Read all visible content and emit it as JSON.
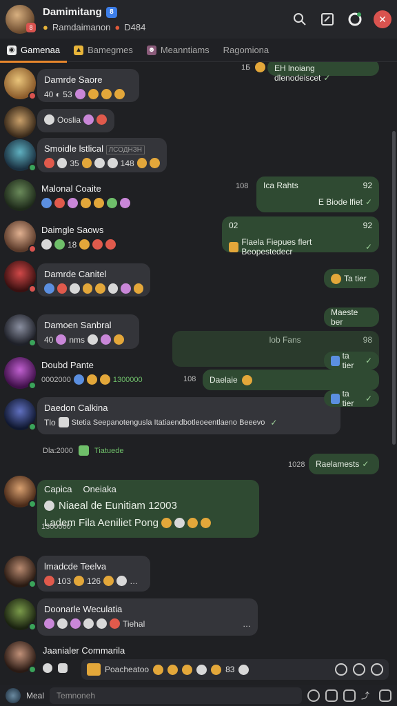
{
  "header": {
    "title": "Damimitang",
    "subtitle": "Ramdaimanon",
    "subtitle_count": "D484",
    "avatar_badge": "8",
    "title_badge": "8"
  },
  "tabs": [
    {
      "label": "Gamenaa",
      "active": true
    },
    {
      "label": "Bamegmes"
    },
    {
      "label": "Meanntiams"
    },
    {
      "label": "Ragomiona"
    }
  ],
  "messages": {
    "m0_out": {
      "time": "1Б",
      "text": "EH lnoiang dlenodeiscet"
    },
    "m1": {
      "name": "Damrde Saore",
      "line": "40 ◐ 53"
    },
    "m2": {
      "line": "Ooslia"
    },
    "m3": {
      "name": "Smoidle lstlical",
      "tag": "ЛСОДНЗН",
      "line": "35",
      "count": "148"
    },
    "m4": {
      "name": "Malonal Coaite"
    },
    "m4_out": {
      "time": "108",
      "title": "Ica Rahts",
      "num": "92",
      "text": "E Biode lfiet"
    },
    "m5": {
      "name": "Daimgle Saows",
      "line": "18"
    },
    "m5_out": {
      "num_l": "02",
      "num_r": "92",
      "text": "Flaela Fiepues flert Beopestedecr"
    },
    "m6": {
      "name": "Damrde Canitel"
    },
    "m6_out": {
      "text": "Ta tier"
    },
    "m7": {
      "name": "Damoen Sanbral",
      "line": "40",
      "line2": "nms"
    },
    "m7_out": {
      "text": "Maeste ber"
    },
    "m7_out2": {
      "title": "lob Fans",
      "num": "98",
      "text": "ta tier"
    },
    "m8": {
      "name": "Doubd Pante",
      "meta_left": "0002000",
      "meta_right": "1300000"
    },
    "m8_out": {
      "time": "108",
      "text": "Daelaie"
    },
    "m9": {
      "name": "Daedon Calkina",
      "line": "Tlo",
      "text": "Stetia Seepanotengusla Itatiaendbotleoeentlaeno Beeevo"
    },
    "m9_out": {
      "text": "ta tier"
    },
    "m9_meta": {
      "left": "Dla:2000",
      "right": "Tiatuede"
    },
    "m10_out": {
      "time": "1028",
      "text": "Raelamests"
    },
    "m11": {
      "name": "Capica",
      "name2": "Oneiaka",
      "line1": "Niaeal de Eunitiam 12003",
      "line2": "Ladem Fila Aeniliet Pong",
      "meta": "1300000"
    },
    "m12": {
      "name": "lmadcde Teelva",
      "line": "103",
      "count": "126"
    },
    "m13": {
      "name": "Doonarle Weculatia",
      "line": "Tiehal"
    },
    "m14": {
      "name": "Jaanialer Commarila"
    }
  },
  "composer": {
    "placeholder": "Poacheatoo",
    "count": "83"
  },
  "bottom": {
    "label": "Meal",
    "placeholder": "Temnoneh"
  }
}
